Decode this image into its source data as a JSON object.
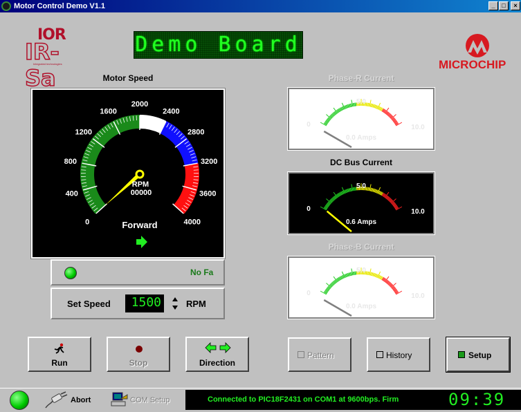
{
  "window": {
    "title": "Motor Control Demo V1.1",
    "min_glyph": "_",
    "max_glyph": "□",
    "close_glyph": "×"
  },
  "logos": {
    "ior_top": "IOR",
    "ior_bottom": "IR-Sa",
    "ior_tagline": "Integrated technologies",
    "microchip": "MICROCHIP"
  },
  "banner": {
    "text": "Demo Board"
  },
  "speedometer": {
    "title": "Motor Speed",
    "unit_label": "RPM",
    "readout": "00000",
    "direction": "Forward",
    "min": 0,
    "max": 4000,
    "value": 0,
    "ticks": [
      "0",
      "400",
      "800",
      "1200",
      "1600",
      "2000",
      "2400",
      "2800",
      "3200",
      "3600",
      "4000"
    ]
  },
  "fault": {
    "text": "No Fa"
  },
  "set_speed": {
    "label": "Set Speed",
    "value": "1500",
    "unit": "RPM"
  },
  "gauges": [
    {
      "title": "Phase-R Current",
      "mid": "5.0",
      "min": "0",
      "max": "10.0",
      "value": 0.0,
      "reading": "0.0 Amps",
      "dark": false,
      "enabled": false
    },
    {
      "title": "DC Bus Current",
      "mid": "5.0",
      "min": "0",
      "max": "10.0",
      "value": 0.6,
      "reading": "0.6 Amps",
      "dark": true,
      "enabled": true
    },
    {
      "title": "Phase-B Current",
      "mid": "5.0",
      "min": "0",
      "max": "10.0",
      "value": 0.0,
      "reading": "0.0 Amps",
      "dark": false,
      "enabled": false
    }
  ],
  "buttons": {
    "run": "Run",
    "stop": "Stop",
    "direction": "Direction",
    "pattern": "Pattern",
    "history": "History",
    "setup": "Setup"
  },
  "status": {
    "abort": "Abort",
    "com_setup": "COM Setup",
    "message": "Connected to PIC18F2431 on COM1 at 9600bps.  Firm",
    "clock": "09:39"
  },
  "colors": {
    "lcd_green": "#22ee22",
    "arc_green": "#1a8a1a",
    "arc_blue": "#1010ff",
    "arc_red": "#ff1010",
    "needle": "#ffff00"
  }
}
